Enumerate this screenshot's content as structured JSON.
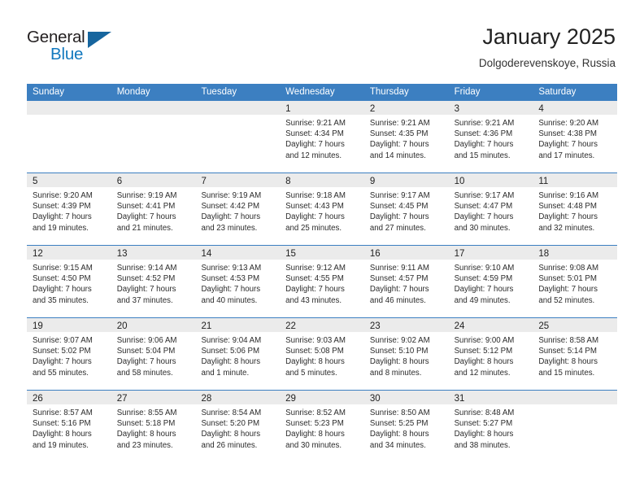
{
  "brand": {
    "name_part1": "General",
    "name_part2": "Blue",
    "accent_color": "#1278be",
    "triangle_color": "#16659e"
  },
  "header": {
    "month_title": "January 2025",
    "location": "Dolgoderevenskoye, Russia"
  },
  "calendar": {
    "header_bg": "#3c7fc1",
    "daynum_strip_bg": "#ebebeb",
    "weekdays": [
      "Sunday",
      "Monday",
      "Tuesday",
      "Wednesday",
      "Thursday",
      "Friday",
      "Saturday"
    ],
    "weeks": [
      [
        {
          "day": "",
          "lines": []
        },
        {
          "day": "",
          "lines": []
        },
        {
          "day": "",
          "lines": []
        },
        {
          "day": "1",
          "lines": [
            "Sunrise: 9:21 AM",
            "Sunset: 4:34 PM",
            "Daylight: 7 hours",
            "and 12 minutes."
          ]
        },
        {
          "day": "2",
          "lines": [
            "Sunrise: 9:21 AM",
            "Sunset: 4:35 PM",
            "Daylight: 7 hours",
            "and 14 minutes."
          ]
        },
        {
          "day": "3",
          "lines": [
            "Sunrise: 9:21 AM",
            "Sunset: 4:36 PM",
            "Daylight: 7 hours",
            "and 15 minutes."
          ]
        },
        {
          "day": "4",
          "lines": [
            "Sunrise: 9:20 AM",
            "Sunset: 4:38 PM",
            "Daylight: 7 hours",
            "and 17 minutes."
          ]
        }
      ],
      [
        {
          "day": "5",
          "lines": [
            "Sunrise: 9:20 AM",
            "Sunset: 4:39 PM",
            "Daylight: 7 hours",
            "and 19 minutes."
          ]
        },
        {
          "day": "6",
          "lines": [
            "Sunrise: 9:19 AM",
            "Sunset: 4:41 PM",
            "Daylight: 7 hours",
            "and 21 minutes."
          ]
        },
        {
          "day": "7",
          "lines": [
            "Sunrise: 9:19 AM",
            "Sunset: 4:42 PM",
            "Daylight: 7 hours",
            "and 23 minutes."
          ]
        },
        {
          "day": "8",
          "lines": [
            "Sunrise: 9:18 AM",
            "Sunset: 4:43 PM",
            "Daylight: 7 hours",
            "and 25 minutes."
          ]
        },
        {
          "day": "9",
          "lines": [
            "Sunrise: 9:17 AM",
            "Sunset: 4:45 PM",
            "Daylight: 7 hours",
            "and 27 minutes."
          ]
        },
        {
          "day": "10",
          "lines": [
            "Sunrise: 9:17 AM",
            "Sunset: 4:47 PM",
            "Daylight: 7 hours",
            "and 30 minutes."
          ]
        },
        {
          "day": "11",
          "lines": [
            "Sunrise: 9:16 AM",
            "Sunset: 4:48 PM",
            "Daylight: 7 hours",
            "and 32 minutes."
          ]
        }
      ],
      [
        {
          "day": "12",
          "lines": [
            "Sunrise: 9:15 AM",
            "Sunset: 4:50 PM",
            "Daylight: 7 hours",
            "and 35 minutes."
          ]
        },
        {
          "day": "13",
          "lines": [
            "Sunrise: 9:14 AM",
            "Sunset: 4:52 PM",
            "Daylight: 7 hours",
            "and 37 minutes."
          ]
        },
        {
          "day": "14",
          "lines": [
            "Sunrise: 9:13 AM",
            "Sunset: 4:53 PM",
            "Daylight: 7 hours",
            "and 40 minutes."
          ]
        },
        {
          "day": "15",
          "lines": [
            "Sunrise: 9:12 AM",
            "Sunset: 4:55 PM",
            "Daylight: 7 hours",
            "and 43 minutes."
          ]
        },
        {
          "day": "16",
          "lines": [
            "Sunrise: 9:11 AM",
            "Sunset: 4:57 PM",
            "Daylight: 7 hours",
            "and 46 minutes."
          ]
        },
        {
          "day": "17",
          "lines": [
            "Sunrise: 9:10 AM",
            "Sunset: 4:59 PM",
            "Daylight: 7 hours",
            "and 49 minutes."
          ]
        },
        {
          "day": "18",
          "lines": [
            "Sunrise: 9:08 AM",
            "Sunset: 5:01 PM",
            "Daylight: 7 hours",
            "and 52 minutes."
          ]
        }
      ],
      [
        {
          "day": "19",
          "lines": [
            "Sunrise: 9:07 AM",
            "Sunset: 5:02 PM",
            "Daylight: 7 hours",
            "and 55 minutes."
          ]
        },
        {
          "day": "20",
          "lines": [
            "Sunrise: 9:06 AM",
            "Sunset: 5:04 PM",
            "Daylight: 7 hours",
            "and 58 minutes."
          ]
        },
        {
          "day": "21",
          "lines": [
            "Sunrise: 9:04 AM",
            "Sunset: 5:06 PM",
            "Daylight: 8 hours",
            "and 1 minute."
          ]
        },
        {
          "day": "22",
          "lines": [
            "Sunrise: 9:03 AM",
            "Sunset: 5:08 PM",
            "Daylight: 8 hours",
            "and 5 minutes."
          ]
        },
        {
          "day": "23",
          "lines": [
            "Sunrise: 9:02 AM",
            "Sunset: 5:10 PM",
            "Daylight: 8 hours",
            "and 8 minutes."
          ]
        },
        {
          "day": "24",
          "lines": [
            "Sunrise: 9:00 AM",
            "Sunset: 5:12 PM",
            "Daylight: 8 hours",
            "and 12 minutes."
          ]
        },
        {
          "day": "25",
          "lines": [
            "Sunrise: 8:58 AM",
            "Sunset: 5:14 PM",
            "Daylight: 8 hours",
            "and 15 minutes."
          ]
        }
      ],
      [
        {
          "day": "26",
          "lines": [
            "Sunrise: 8:57 AM",
            "Sunset: 5:16 PM",
            "Daylight: 8 hours",
            "and 19 minutes."
          ]
        },
        {
          "day": "27",
          "lines": [
            "Sunrise: 8:55 AM",
            "Sunset: 5:18 PM",
            "Daylight: 8 hours",
            "and 23 minutes."
          ]
        },
        {
          "day": "28",
          "lines": [
            "Sunrise: 8:54 AM",
            "Sunset: 5:20 PM",
            "Daylight: 8 hours",
            "and 26 minutes."
          ]
        },
        {
          "day": "29",
          "lines": [
            "Sunrise: 8:52 AM",
            "Sunset: 5:23 PM",
            "Daylight: 8 hours",
            "and 30 minutes."
          ]
        },
        {
          "day": "30",
          "lines": [
            "Sunrise: 8:50 AM",
            "Sunset: 5:25 PM",
            "Daylight: 8 hours",
            "and 34 minutes."
          ]
        },
        {
          "day": "31",
          "lines": [
            "Sunrise: 8:48 AM",
            "Sunset: 5:27 PM",
            "Daylight: 8 hours",
            "and 38 minutes."
          ]
        },
        {
          "day": "",
          "lines": []
        }
      ]
    ]
  }
}
